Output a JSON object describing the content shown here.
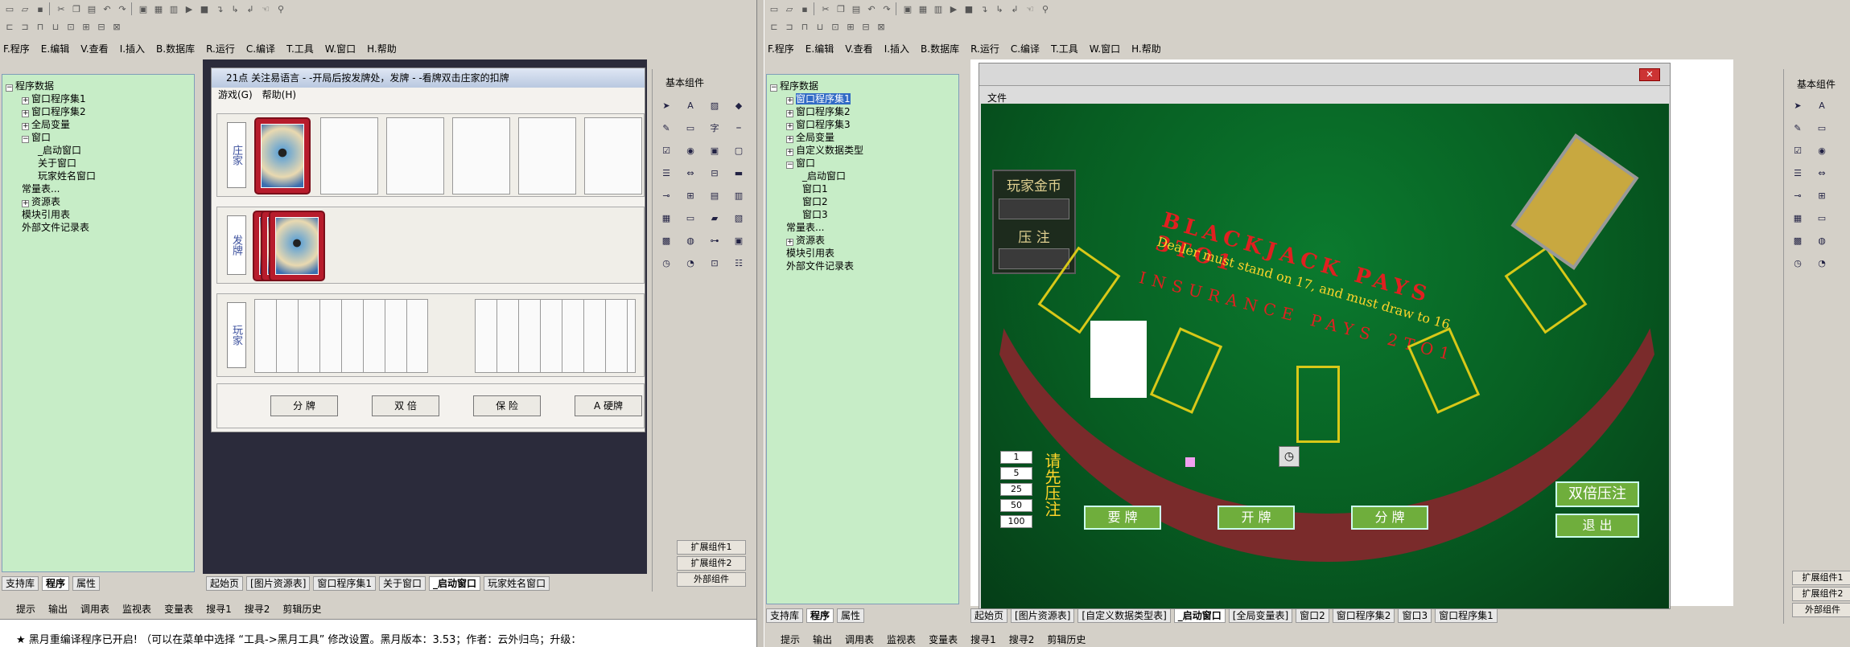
{
  "left": {
    "menu": [
      "F.程序",
      "E.编辑",
      "V.查看",
      "I.插入",
      "B.数据库",
      "R.运行",
      "C.编译",
      "T.工具",
      "W.窗口",
      "H.帮助"
    ],
    "tree": {
      "root": "程序数据",
      "items": [
        {
          "label": "窗口程序集1",
          "level": 1
        },
        {
          "label": "窗口程序集2",
          "level": 1
        },
        {
          "label": "全局变量",
          "level": 1
        },
        {
          "label": "窗口",
          "level": 1
        },
        {
          "label": "_启动窗口",
          "level": 2
        },
        {
          "label": "关于窗口",
          "level": 2
        },
        {
          "label": "玩家姓名窗口",
          "level": 2
        },
        {
          "label": "常量表...",
          "level": 1
        },
        {
          "label": "资源表",
          "level": 1
        },
        {
          "label": "模块引用表",
          "level": 1
        },
        {
          "label": "外部文件记录表",
          "level": 1
        }
      ]
    },
    "form": {
      "title": "21点 关注易语言 - -开局后按发牌处，发牌 - -看牌双击庄家的扣牌",
      "menu": [
        "游戏(G)",
        "帮助(H)"
      ],
      "zones": [
        "庄家",
        "发牌",
        "玩家"
      ],
      "buttons": [
        "分 牌",
        "双 倍",
        "保 险",
        "A 硬牌"
      ]
    },
    "components_title": "基本组件",
    "component_buttons": [
      "扩展组件1",
      "扩展组件2",
      "外部组件"
    ],
    "bottom_tabs": [
      "支持库",
      "程序",
      "属性"
    ],
    "doc_tabs": [
      "起始页",
      "[图片资源表]",
      "窗口程序集1",
      "关于窗口",
      "_启动窗口",
      "玩家姓名窗口"
    ],
    "status_tabs": [
      "提示",
      "输出",
      "调用表",
      "监视表",
      "变量表",
      "搜寻1",
      "搜寻2",
      "剪辑历史"
    ],
    "message": "★ 黑月重编译程序已开启! （可以在菜单中选择 “工具->黑月工具” 修改设置。黑月版本：3.53；作者：云外归鸟；升级："
  },
  "right": {
    "menu": [
      "F.程序",
      "E.编辑",
      "V.查看",
      "I.插入",
      "B.数据库",
      "R.运行",
      "C.编译",
      "T.工具",
      "W.窗口",
      "H.帮助"
    ],
    "tree": {
      "root": "程序数据",
      "items": [
        {
          "label": "窗口程序集1",
          "level": 1
        },
        {
          "label": "窗口程序集2",
          "level": 1
        },
        {
          "label": "窗口程序集3",
          "level": 1
        },
        {
          "label": "全局变量",
          "level": 1
        },
        {
          "label": "自定义数据类型",
          "level": 1
        },
        {
          "label": "窗口",
          "level": 1
        },
        {
          "label": "_启动窗口",
          "level": 2
        },
        {
          "label": "窗口1",
          "level": 2
        },
        {
          "label": "窗口2",
          "level": 2
        },
        {
          "label": "窗口3",
          "level": 2
        },
        {
          "label": "常量表...",
          "level": 1
        },
        {
          "label": "资源表",
          "level": 1
        },
        {
          "label": "模块引用表",
          "level": 1
        },
        {
          "label": "外部文件记录表",
          "level": 1
        }
      ]
    },
    "form_menu": "文件",
    "table": {
      "line1": "BLACKJACK PAYS 3TO1",
      "line2": "Dealer must stand on 17, and must draw to 16",
      "line3": "INSURANCE PAYS 2TO1",
      "coin_label": "玩家金币",
      "bet_label": "压 注",
      "chips": [
        "1",
        "5",
        "25",
        "50",
        "100"
      ],
      "prompt": "请先压注",
      "double_btn": "双倍压注",
      "btn_a": "要 牌",
      "btn_b": "开 牌",
      "btn_c": "分 牌",
      "btn_d": "退 出"
    },
    "components_title": "基本组件",
    "component_buttons": [
      "扩展组件1",
      "扩展组件2",
      "外部组件"
    ],
    "bottom_tabs": [
      "支持库",
      "程序",
      "属性"
    ],
    "doc_tabs": [
      "起始页",
      "[图片资源表]",
      "[自定义数据类型表]",
      "_启动窗口",
      "[全局变量表]",
      "窗口2",
      "窗口程序集2",
      "窗口3",
      "窗口程序集1"
    ],
    "status_tabs": [
      "提示",
      "输出",
      "调用表",
      "监视表",
      "变量表",
      "搜寻1",
      "搜寻2",
      "剪辑历史"
    ]
  }
}
